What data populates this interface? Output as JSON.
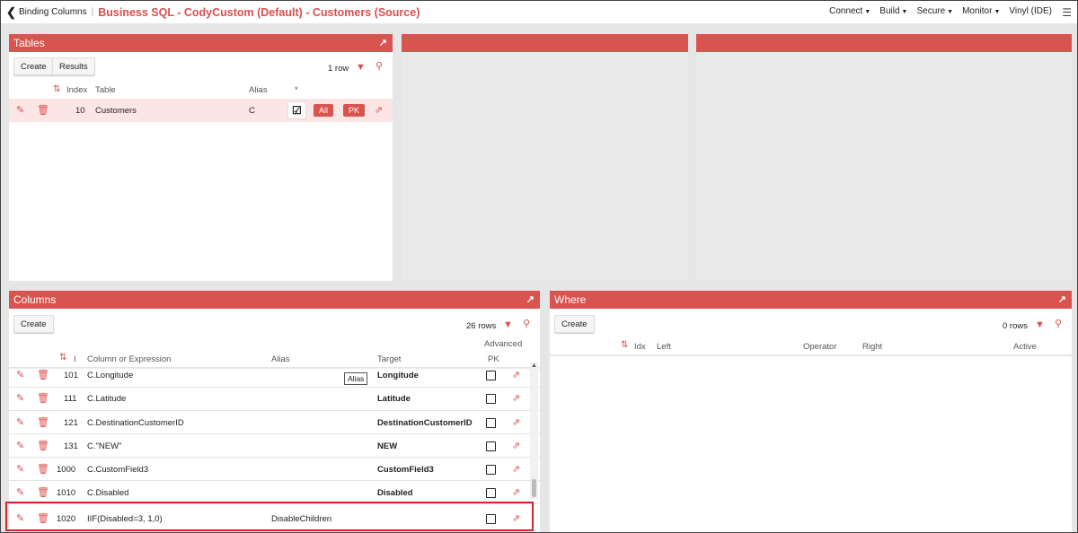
{
  "topbar": {
    "back_icon": "chevron-left-icon",
    "breadcrumb": "Binding Columns",
    "separator": "|",
    "title": "Business SQL - CodyCustom (Default) - Customers (Source)",
    "menu": [
      {
        "label": "Connect"
      },
      {
        "label": "Build"
      },
      {
        "label": "Secure"
      },
      {
        "label": "Monitor"
      },
      {
        "label": "Vinyl (IDE)"
      }
    ]
  },
  "tables": {
    "title": "Tables",
    "create": "Create",
    "results": "Results",
    "row_count": "1 row",
    "headers": {
      "index": "Index",
      "table": "Table",
      "alias": "Alias",
      "star": "*"
    },
    "rows": [
      {
        "index": "10",
        "table": "Customers",
        "alias": "C",
        "all": "All",
        "pk": "PK"
      }
    ]
  },
  "columns": {
    "title": "Columns",
    "create": "Create",
    "row_count": "26 rows",
    "headers": {
      "i": "I",
      "expr": "Column or Expression",
      "alias": "Alias",
      "target": "Target",
      "advanced": "Advanced",
      "pk": "PK"
    },
    "tooltip": "Alias",
    "rows": [
      {
        "idx": "101",
        "expr": "C.Longitude",
        "alias": "",
        "target": "Longitude"
      },
      {
        "idx": "111",
        "expr": "C.Latitude",
        "alias": "",
        "target": "Latitude"
      },
      {
        "idx": "121",
        "expr": "C.DestinationCustomerID",
        "alias": "",
        "target": "DestinationCustomerID"
      },
      {
        "idx": "131",
        "expr": "C.\"NEW\"",
        "alias": "",
        "target": "NEW"
      },
      {
        "idx": "1000",
        "expr": "C.CustomField3",
        "alias": "",
        "target": "CustomField3"
      },
      {
        "idx": "1010",
        "expr": "C.Disabled",
        "alias": "",
        "target": "Disabled"
      },
      {
        "idx": "1020",
        "expr": "IIF(Disabled=3, 1,0)",
        "alias": "DisableChildren",
        "target": ""
      }
    ]
  },
  "where": {
    "title": "Where",
    "create": "Create",
    "row_count": "0 rows",
    "headers": {
      "idx": "Idx",
      "left": "Left",
      "operator": "Operator",
      "right": "Right",
      "active": "Active"
    }
  },
  "colors": {
    "accent": "#d9534f",
    "highlight": "#d9222a"
  }
}
